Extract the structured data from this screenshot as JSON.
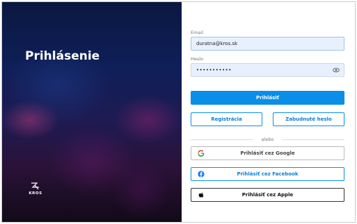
{
  "left_panel": {
    "title": "Prihlásenie",
    "logo_text": "KROS"
  },
  "form": {
    "email_label": "Email",
    "email_value": "duratna@kros.sk",
    "password_label": "Heslo",
    "password_value": "•••••••••••"
  },
  "buttons": {
    "login": "Prihlásiť",
    "register": "Registrácia",
    "forgot_password": "Zabudnuté heslo",
    "divider": "alebo",
    "google": "Prihlásiť cez Google",
    "facebook": "Prihlásiť cez Facebook",
    "apple": "Prihlásiť cez Apple"
  },
  "colors": {
    "primary": "#0a8ee8",
    "facebook": "#1877f2",
    "input_bg": "#e8f0fe"
  },
  "icons": {
    "password_toggle": "eye-icon",
    "google": "google-icon",
    "facebook": "facebook-icon",
    "apple": "apple-icon",
    "logo": "kros-logo"
  }
}
